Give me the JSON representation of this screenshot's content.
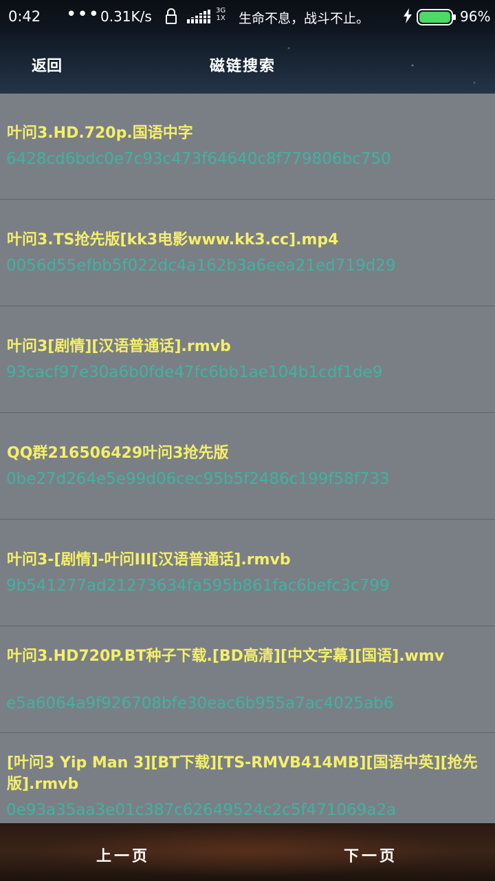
{
  "status_bar": {
    "time": "0:42",
    "dots": "•••",
    "net_speed": "0.31K/s",
    "network_type_top": "3G",
    "network_type_bottom": "1X",
    "slogan": "生命不息，战斗不止。",
    "battery_percent": "96%",
    "battery_level": 0.96
  },
  "header": {
    "back_label": "返回",
    "title": "磁链搜索"
  },
  "results": [
    {
      "title": "叶问3.HD.720p.国语中字",
      "hash": "6428cd6bdc0e7c93c473f64640c8f779806bc750"
    },
    {
      "title": "叶问3.TS抢先版[kk3电影www.kk3.cc].mp4",
      "hash": "0056d55efbb5f022dc4a162b3a6eea21ed719d29"
    },
    {
      "title": "叶问3[剧情][汉语普通话].rmvb",
      "hash": "93cacf97e30a6b0fde47fc6bb1ae104b1cdf1de9"
    },
    {
      "title": "QQ群216506429叶问3抢先版",
      "hash": "0be27d264e5e99d06cec95b5f2486c199f58f733"
    },
    {
      "title": "叶问3-[剧情]-叶问III[汉语普通话].rmvb",
      "hash": "9b541277ad21273634fa595b861fac6befc3c799"
    },
    {
      "title": "叶问3.HD720P.BT种子下载.[BD高清][中文字幕][国语].wmv",
      "hash": "e5a6064a9f926708bfe30eac6b955a7ac4025ab6"
    },
    {
      "title": "[叶问3 Yip Man 3][BT下载][TS-RMVB414MB][国语中英][抢先版].rmvb",
      "hash": "0e93a35aa3e01c387c62649524c2c5f471069a2a"
    }
  ],
  "footer": {
    "prev_label": "上一页",
    "next_label": "下一页"
  }
}
